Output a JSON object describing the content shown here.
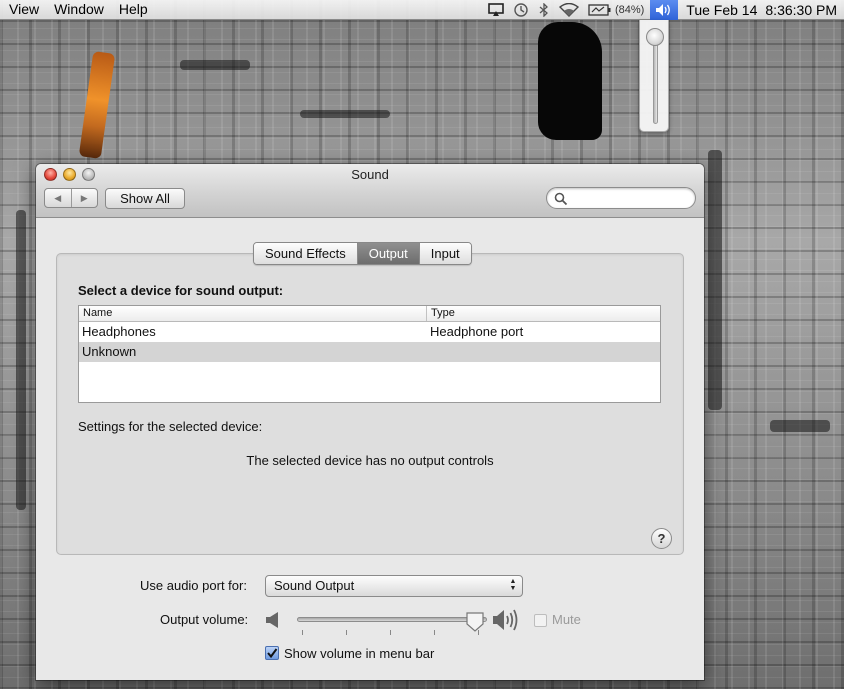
{
  "menubar": {
    "menus": [
      "View",
      "Window",
      "Help"
    ],
    "status_icons": [
      "airplay-icon",
      "time-machine-icon",
      "bluetooth-icon",
      "wifi-icon",
      "battery-icon",
      "volume-icon"
    ],
    "battery_percent": "(84%)",
    "date": "Tue Feb 14",
    "time": "8:36:30 PM"
  },
  "volume_menu": {
    "level": 1.0
  },
  "window": {
    "title": "Sound",
    "nav_back": "◀",
    "nav_forward": "▶",
    "show_all_label": "Show All",
    "search": {
      "value": "",
      "placeholder": ""
    }
  },
  "tabs": [
    {
      "label": "Sound Effects",
      "active": false
    },
    {
      "label": "Output",
      "active": true
    },
    {
      "label": "Input",
      "active": false
    }
  ],
  "output": {
    "heading": "Select a device for sound output:",
    "columns": [
      "Name",
      "Type"
    ],
    "devices": [
      {
        "name": "Headphones",
        "type": "Headphone port",
        "selected": false
      },
      {
        "name": "Unknown",
        "type": "",
        "selected": true
      }
    ],
    "settings_label": "Settings for the selected device:",
    "no_controls": "The selected device has no output controls",
    "help_label": "?"
  },
  "bottom": {
    "port_label": "Use audio port for:",
    "port_value": "Sound Output",
    "volume_label": "Output volume:",
    "volume_level": 0.95,
    "mute_label": "Mute",
    "mute_checked": false,
    "mute_enabled": false,
    "show_in_menubar_label": "Show volume in menu bar",
    "show_in_menubar_checked": true
  },
  "colors": {
    "menu_highlight": "#3a6ee0",
    "selected_row": "#d4d4d4",
    "active_tab": "#7a7a7a"
  }
}
